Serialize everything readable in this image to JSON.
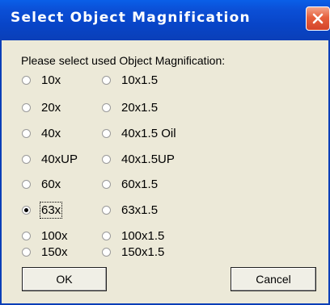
{
  "window": {
    "title": "Select Object Magnification"
  },
  "prompt": "Please select used Object Magnification:",
  "options": {
    "left": [
      {
        "label": "10x",
        "checked": false
      },
      {
        "label": "20x",
        "checked": false
      },
      {
        "label": "40x",
        "checked": false
      },
      {
        "label": "40xUP",
        "checked": false
      },
      {
        "label": "60x",
        "checked": false
      },
      {
        "label": "63x",
        "checked": true
      },
      {
        "label": "100x",
        "checked": false
      },
      {
        "label": "150x",
        "checked": false
      }
    ],
    "right": [
      {
        "label": "10x1.5",
        "checked": false
      },
      {
        "label": "20x1.5",
        "checked": false
      },
      {
        "label": "40x1.5 Oil",
        "checked": false
      },
      {
        "label": "40x1.5UP",
        "checked": false
      },
      {
        "label": "60x1.5",
        "checked": false
      },
      {
        "label": "63x1.5",
        "checked": false
      },
      {
        "label": "100x1.5",
        "checked": false
      },
      {
        "label": "150x1.5",
        "checked": false
      }
    ]
  },
  "buttons": {
    "ok": "OK",
    "cancel": "Cancel"
  },
  "icons": {
    "close": "close-icon"
  },
  "colors": {
    "titlebar": "#0a46c8",
    "close_button": "#e0583a",
    "dialog_background": "#ece9d8"
  }
}
